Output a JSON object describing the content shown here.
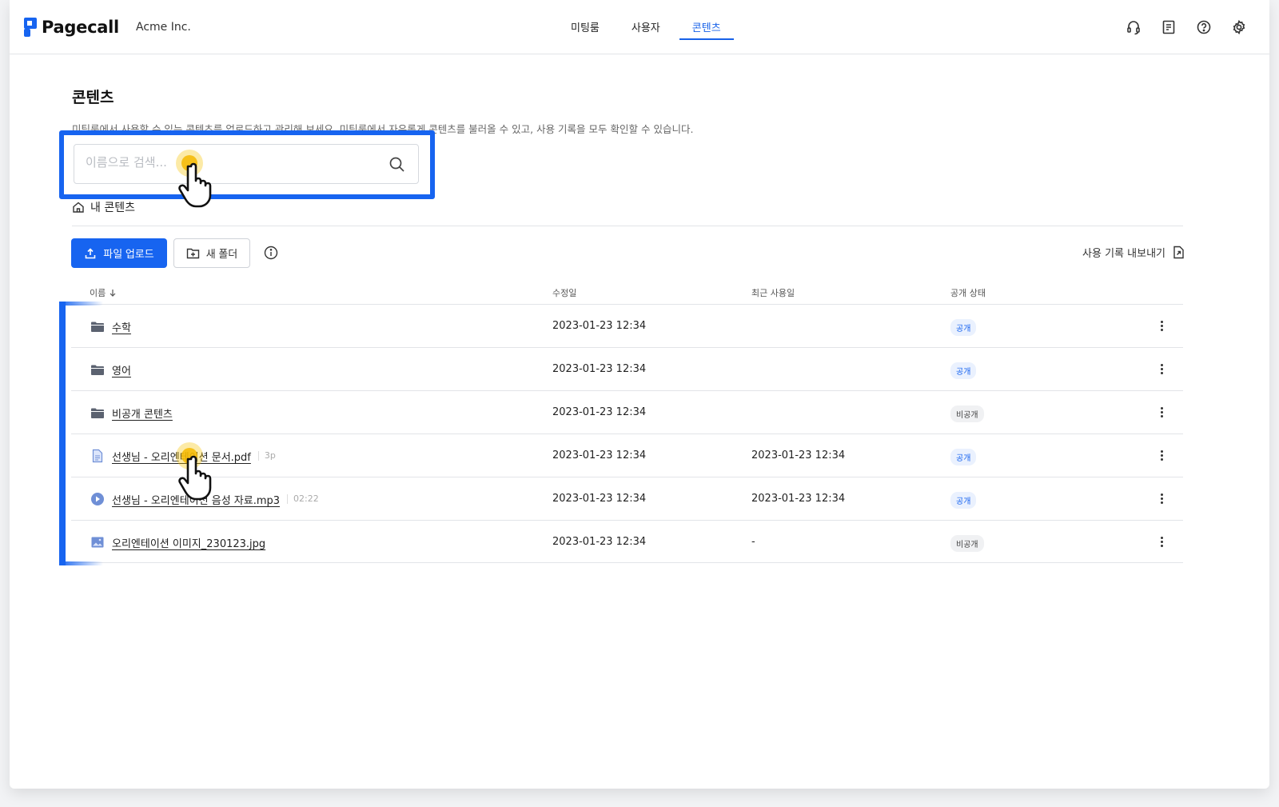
{
  "header": {
    "logo_text": "Pagecall",
    "org_name": "Acme Inc.",
    "nav": [
      {
        "label": "미팅룸",
        "active": false
      },
      {
        "label": "사용자",
        "active": false
      },
      {
        "label": "콘텐츠",
        "active": true
      }
    ],
    "icons": [
      "headset-icon",
      "document-icon",
      "help-icon",
      "settings-icon"
    ]
  },
  "page": {
    "title": "콘텐츠",
    "description": "미팅룸에서 사용할 수 있는 콘텐츠를 업로드하고 관리해 보세요. 미팅룸에서 자유롭게 콘텐츠를 불러올 수 있고, 사용 기록을 모두 확인할 수 있습니다."
  },
  "search": {
    "placeholder": "이름으로 검색...",
    "value": ""
  },
  "breadcrumb": {
    "label": "내 콘텐츠"
  },
  "toolbar": {
    "upload_label": "파일 업로드",
    "new_folder_label": "새 폴더",
    "export_label": "사용 기록 내보내기"
  },
  "table": {
    "headers": {
      "name": "이름",
      "modified": "수정일",
      "last_used": "최근 사용일",
      "status": "공개 상태"
    },
    "rows": [
      {
        "type": "folder",
        "name": "수학",
        "meta": "",
        "modified": "2023-01-23 12:34",
        "last_used": "",
        "status": "공개",
        "public": true
      },
      {
        "type": "folder",
        "name": "영어",
        "meta": "",
        "modified": "2023-01-23 12:34",
        "last_used": "",
        "status": "공개",
        "public": true
      },
      {
        "type": "folder",
        "name": "비공개 콘텐츠",
        "meta": "",
        "modified": "2023-01-23 12:34",
        "last_used": "",
        "status": "비공개",
        "public": false
      },
      {
        "type": "pdf",
        "name": "선생님 - 오리엔테이션 문서.pdf",
        "meta": "3p",
        "modified": "2023-01-23 12:34",
        "last_used": "2023-01-23 12:34",
        "status": "공개",
        "public": true
      },
      {
        "type": "audio",
        "name": "선생님 - 오리엔테이션 음성 자료.mp3",
        "meta": "02:22",
        "modified": "2023-01-23 12:34",
        "last_used": "2023-01-23 12:34",
        "status": "공개",
        "public": true
      },
      {
        "type": "image",
        "name": "오리엔테이션 이미지_230123.jpg",
        "meta": "",
        "modified": "2023-01-23 12:34",
        "last_used": "-",
        "status": "비공개",
        "public": false
      }
    ]
  },
  "colors": {
    "accent": "#1764f0",
    "highlight": "#1764f0",
    "cursor_glow": "#f7c400"
  }
}
